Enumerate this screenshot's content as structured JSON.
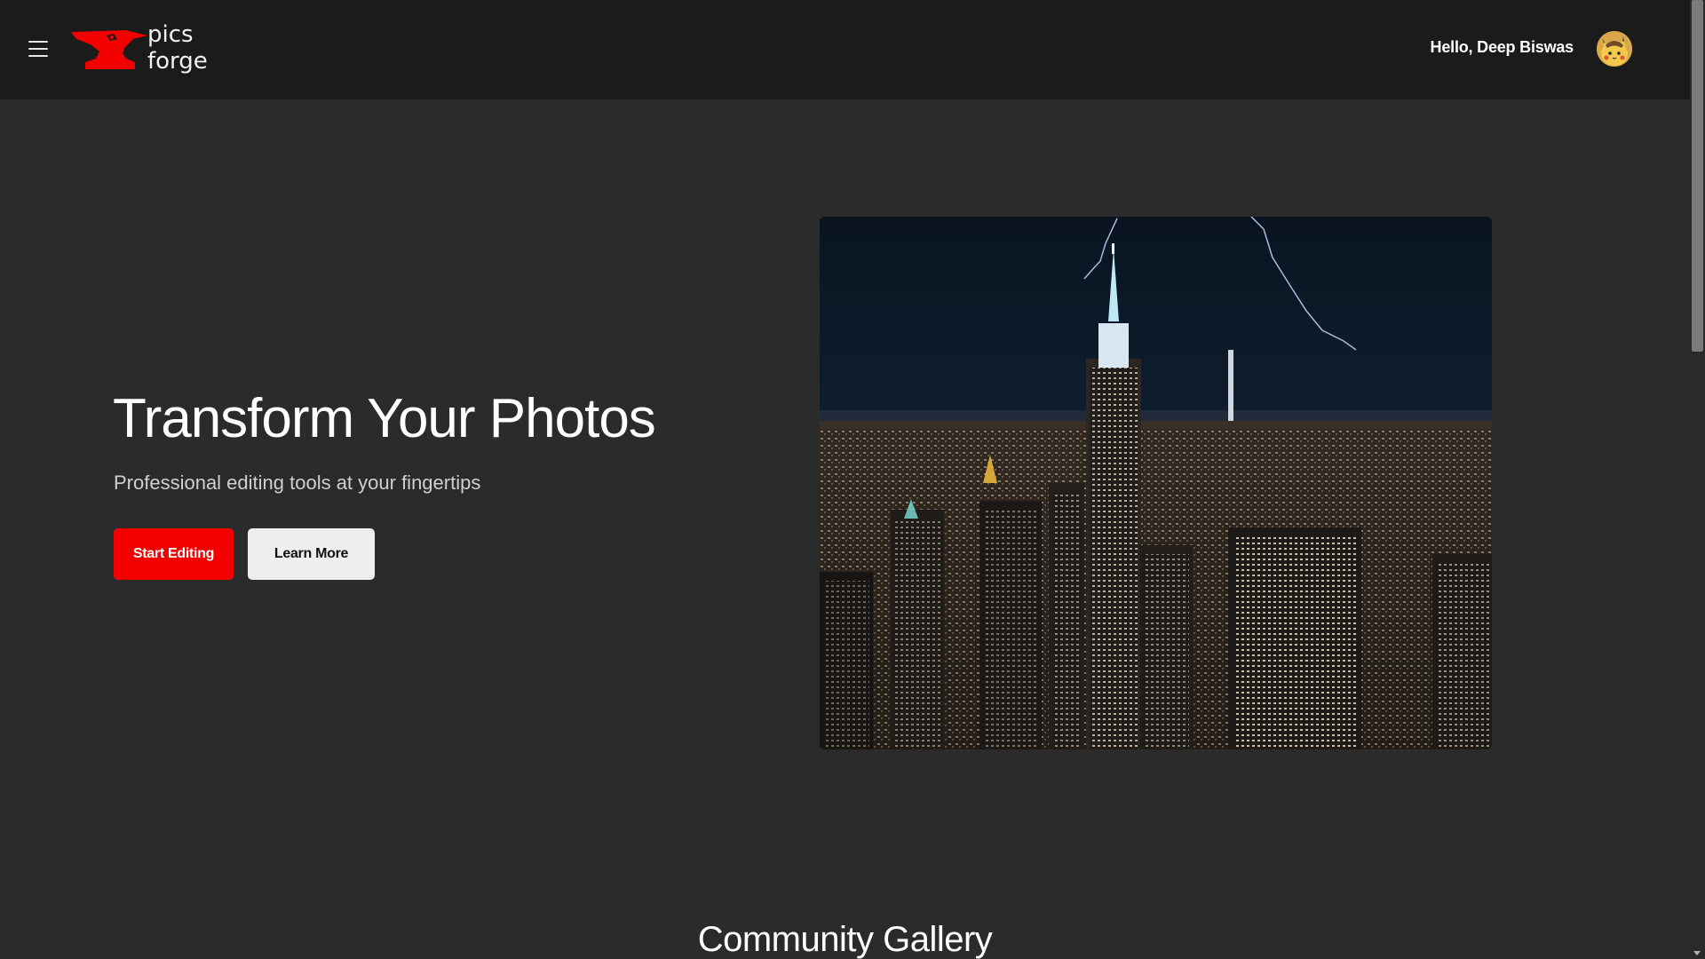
{
  "header": {
    "logo_line1": "pics",
    "logo_line2": "forge",
    "greeting": "Hello, Deep Biswas"
  },
  "hero": {
    "title": "Transform Your Photos",
    "subtitle": "Professional editing tools at your fingertips",
    "primary_button": "Start Editing",
    "secondary_button": "Learn More"
  },
  "gallery": {
    "title": "Community Gallery"
  },
  "colors": {
    "brand_red": "#f20000",
    "header_bg": "#1b1b1b",
    "page_bg": "#2b2b2b"
  },
  "icons": {
    "menu": "hamburger-icon",
    "logo": "anvil-icon",
    "avatar": "pikachu-avatar"
  }
}
